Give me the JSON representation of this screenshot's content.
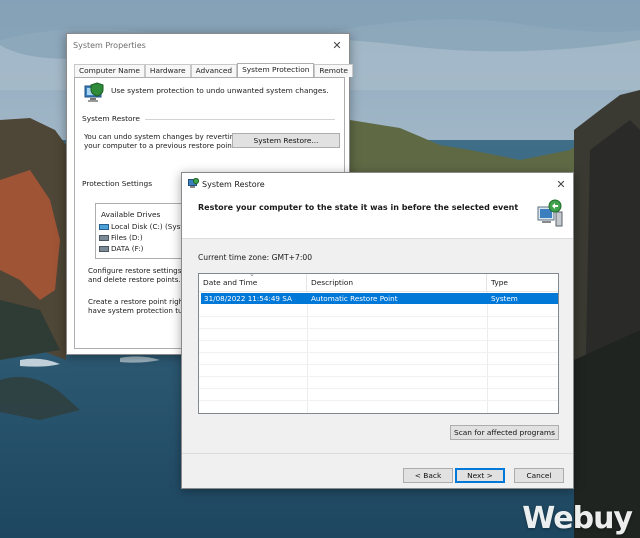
{
  "system_properties": {
    "title": "System Properties",
    "tabs": [
      {
        "label": "Computer Name",
        "active": false
      },
      {
        "label": "Hardware",
        "active": false
      },
      {
        "label": "Advanced",
        "active": false
      },
      {
        "label": "System Protection",
        "active": true
      },
      {
        "label": "Remote",
        "active": false
      }
    ],
    "intro": "Use system protection to undo unwanted system changes.",
    "system_restore_group": "System Restore",
    "restore_desc_line1": "You can undo system changes by reverting",
    "restore_desc_line2": "your computer to a previous restore point.",
    "system_restore_button": "System Restore...",
    "protection_group": "Protection Settings",
    "available_drives_header": "Available Drives",
    "drives": [
      {
        "label": "Local Disk (C:) (System)",
        "type": "system"
      },
      {
        "label": "Files (D:)",
        "type": "data"
      },
      {
        "label": "DATA (F:)",
        "type": "data"
      }
    ],
    "configure_line1": "Configure restore settings, ma",
    "configure_line2": "and delete restore points.",
    "create_line1": "Create a restore point right no",
    "create_line2": "have system protection turne"
  },
  "system_restore": {
    "title": "System Restore",
    "heading": "Restore your computer to the state it was in before the selected event",
    "timezone": "Current time zone: GMT+7:00",
    "columns": [
      "Date and Time",
      "Description",
      "Type"
    ],
    "rows": [
      {
        "date": "31/08/2022 11:54:49 SA",
        "description": "Automatic Restore Point",
        "type": "System",
        "selected": true
      }
    ],
    "scan_button": "Scan for affected programs",
    "back_button": "< Back",
    "next_button": "Next >",
    "cancel_button": "Cancel"
  },
  "watermark": "Webuy",
  "colors": {
    "selection": "#0078d7",
    "window_bg": "#f0f0f0",
    "button_bg": "#e1e1e1"
  },
  "icons": {
    "close": "close-icon",
    "shield_computer": "system-protection-icon",
    "restore": "system-restore-icon",
    "drive": "drive-icon"
  }
}
